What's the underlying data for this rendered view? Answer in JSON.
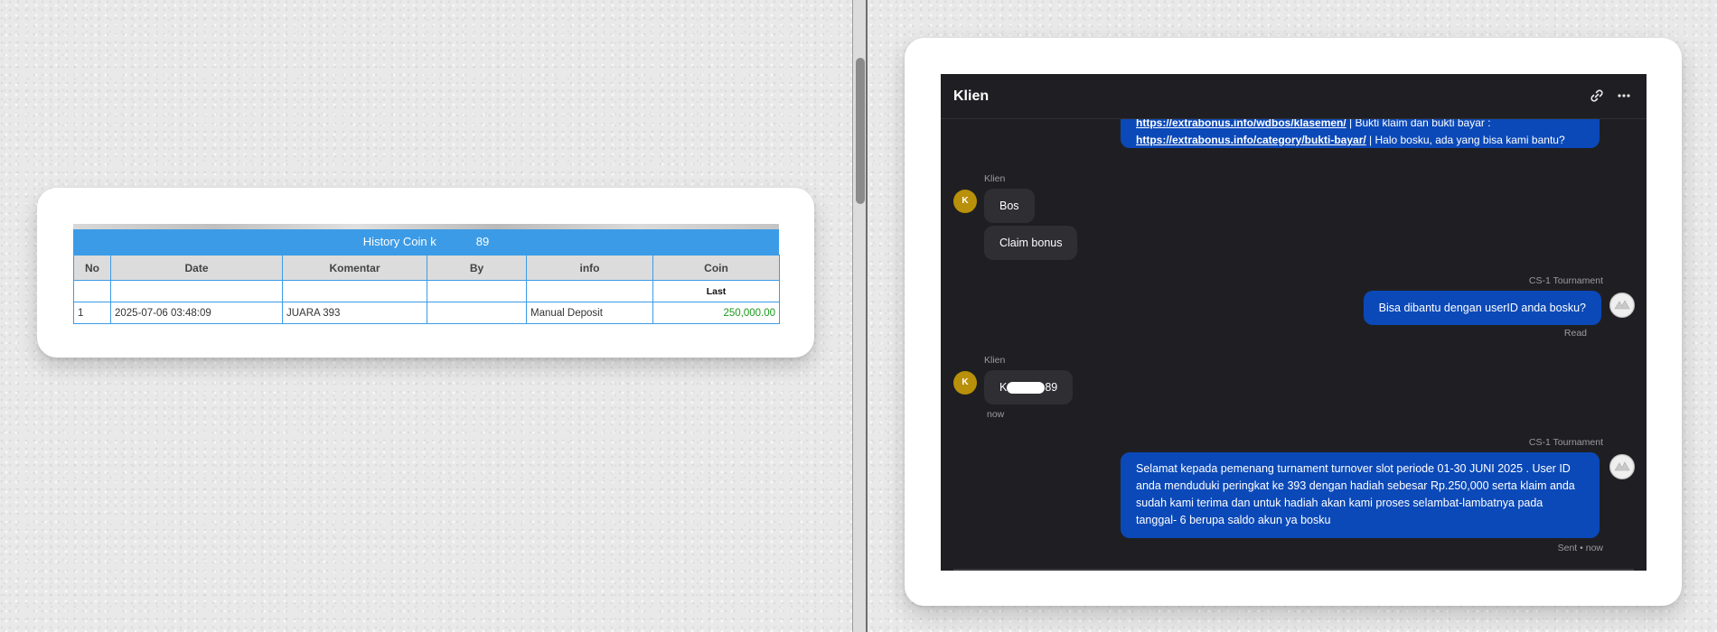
{
  "history": {
    "title_prefix": "History Coin k",
    "title_suffix": "89",
    "columns": [
      "No",
      "Date",
      "Komentar",
      "By",
      "info",
      "Coin"
    ],
    "last_label": "Last",
    "rows": [
      {
        "no": "1",
        "date": "2025-07-06 03:48:09",
        "komentar": "JUARA 393",
        "by": "",
        "info": "Manual Deposit",
        "coin": "250,000.00"
      }
    ]
  },
  "chat": {
    "title": "Klien",
    "icons": {
      "link": "link-icon",
      "more": "more-icon"
    },
    "messages": {
      "m0": {
        "link1": "https://extrabonus.info/wdbos/klasemen/",
        "text1": " | Bukti klaim dan bukti bayar : ",
        "link2": "https://extrabonus.info/category/bukti-bayar/",
        "text2": " | Halo bosku, ada yang bisa kami bantu?"
      },
      "m1": {
        "sender": "Klien",
        "avatar": "K",
        "text": "Bos"
      },
      "m2": {
        "text": "Claim bonus"
      },
      "m3": {
        "sender": "CS-1 Tournament",
        "text": "Bisa dibantu dengan userID anda bosku?",
        "status": "Read"
      },
      "m4": {
        "sender": "Klien",
        "avatar": "K",
        "text_prefix": "K",
        "text_suffix": "89",
        "time": "now"
      },
      "m5": {
        "sender": "CS-1 Tournament",
        "text": "Selamat kepada pemenang turnament turnover slot periode 01-30 JUNI 2025 . User ID anda menduduki peringkat ke 393 dengan hadiah sebesar Rp.250,000 serta klaim anda sudah kami terima dan untuk hadiah akan kami proses selambat-lambatnya pada tanggal- 6 berupa saldo akun ya bosku",
        "status": "Sent • now"
      }
    }
  },
  "colors": {
    "table_header": "#3c9be6",
    "coin_value": "#1a9a1a",
    "chat_bg": "#1f1f23",
    "bubble_out": "#0b49b8",
    "bubble_in": "#2e2e33",
    "avatar_klien": "#b8900a"
  }
}
